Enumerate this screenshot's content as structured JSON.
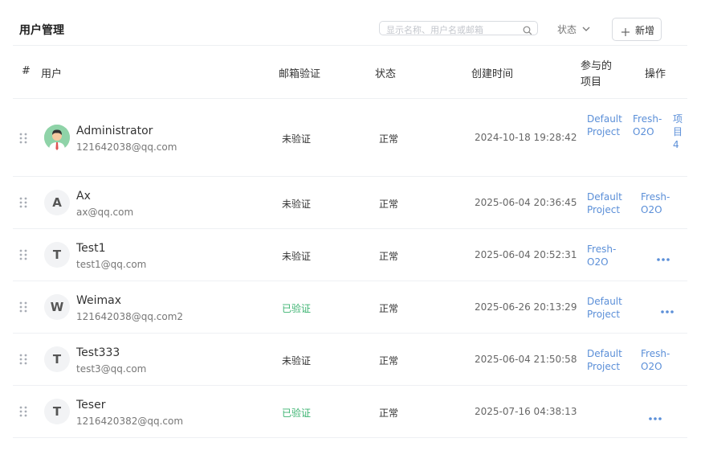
{
  "page_title": "用户管理",
  "search": {
    "placeholder": "显示名称、用户名或邮箱"
  },
  "status_filter": {
    "label": "状态"
  },
  "add_button": {
    "label": "新增"
  },
  "table": {
    "headers": {
      "index": "#",
      "user": "用户",
      "email_verify": "邮箱验证",
      "status": "状态",
      "created": "创建时间",
      "projects_line1": "参与的",
      "projects_line2": "项目",
      "actions": "操作"
    },
    "rows": [
      {
        "avatar": "",
        "name": "Administrator",
        "email": "121642038@qq.com",
        "verify": "未验证",
        "status": "正常",
        "created": "2024-10-18 19:28:42",
        "projects": [
          [
            "Default",
            "Project"
          ],
          [
            "Fresh-",
            "O2O"
          ],
          [
            "项",
            "目",
            "4"
          ]
        ]
      },
      {
        "avatar": "A",
        "name": "Ax",
        "email": "ax@qq.com",
        "verify": "未验证",
        "status": "正常",
        "created": "2025-06-04 20:36:45",
        "projects": [
          [
            "Default",
            "Project"
          ],
          [
            "Fresh-",
            "O2O"
          ]
        ]
      },
      {
        "avatar": "T",
        "name": "Test1",
        "email": "test1@qq.com",
        "verify": "未验证",
        "status": "正常",
        "created": "2025-06-04 20:52:31",
        "projects": [
          [
            "Fresh-",
            "O2O"
          ]
        ]
      },
      {
        "avatar": "W",
        "name": "Weimax",
        "email": "121642038@qq.com2",
        "verify": "已验证",
        "status": "正常",
        "created": "2025-06-26 20:13:29",
        "projects": [
          [
            "Default",
            "Project"
          ]
        ]
      },
      {
        "avatar": "T",
        "name": "Test333",
        "email": "test3@qq.com",
        "verify": "未验证",
        "status": "正常",
        "created": "2025-06-04 21:50:58",
        "projects": [
          [
            "Default",
            "Project"
          ],
          [
            "Fresh-",
            "O2O"
          ]
        ]
      },
      {
        "avatar": "T",
        "name": "Teser",
        "email": "1216420382@qq.com",
        "verify": "已验证",
        "status": "正常",
        "created": "2025-07-16 04:38:13",
        "projects": []
      }
    ]
  },
  "colors": {
    "accent": "#5b8fd8",
    "verified": "#3cb371",
    "divider": "#eef0f3"
  },
  "icons": {
    "search": "search-icon",
    "chevron": "chevron-down-icon",
    "plus": "plus-icon",
    "drag": "drag-handle-icon",
    "more": "more-dots-icon",
    "avatar_admin": "user-avatar-illustration"
  }
}
